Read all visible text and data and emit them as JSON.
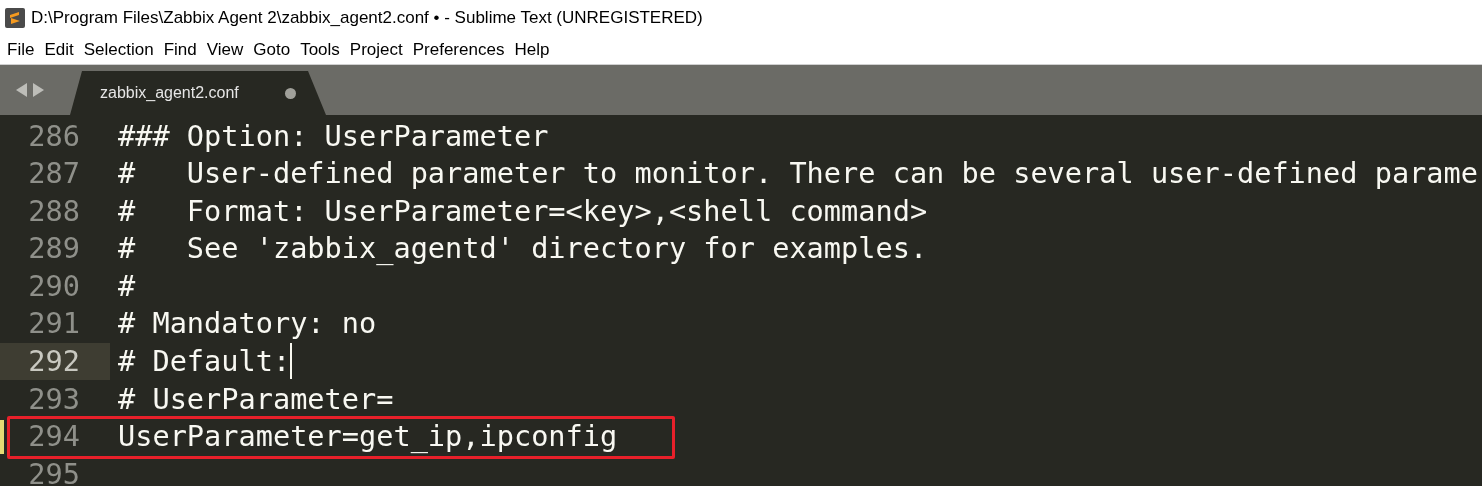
{
  "window": {
    "title": "D:\\Program Files\\Zabbix Agent 2\\zabbix_agent2.conf • - Sublime Text (UNREGISTERED)"
  },
  "menu": [
    "File",
    "Edit",
    "Selection",
    "Find",
    "View",
    "Goto",
    "Tools",
    "Project",
    "Preferences",
    "Help"
  ],
  "tabs": [
    {
      "label": "zabbix_agent2.conf",
      "selected": true,
      "dirty": true
    }
  ],
  "lines": [
    {
      "number": "286",
      "text": "### Option: UserParameter",
      "current": false,
      "modified": false,
      "boxed": false
    },
    {
      "number": "287",
      "text": "#   User-defined parameter to monitor. There can be several user-defined parame",
      "current": false,
      "modified": false,
      "boxed": false
    },
    {
      "number": "288",
      "text": "#   Format: UserParameter=<key>,<shell command>",
      "current": false,
      "modified": false,
      "boxed": false
    },
    {
      "number": "289",
      "text": "#   See 'zabbix_agentd' directory for examples.",
      "current": false,
      "modified": false,
      "boxed": false
    },
    {
      "number": "290",
      "text": "#",
      "current": false,
      "modified": false,
      "boxed": false
    },
    {
      "number": "291",
      "text": "# Mandatory: no",
      "current": false,
      "modified": false,
      "boxed": false
    },
    {
      "number": "292",
      "text": "# Default:",
      "current": true,
      "modified": false,
      "boxed": false
    },
    {
      "number": "293",
      "text": "# UserParameter=",
      "current": false,
      "modified": false,
      "boxed": false
    },
    {
      "number": "294",
      "text": "UserParameter=get_ip,ipconfig",
      "current": false,
      "modified": true,
      "boxed": true
    },
    {
      "number": "295",
      "current": false,
      "modified": false,
      "boxed": false
    }
  ]
}
